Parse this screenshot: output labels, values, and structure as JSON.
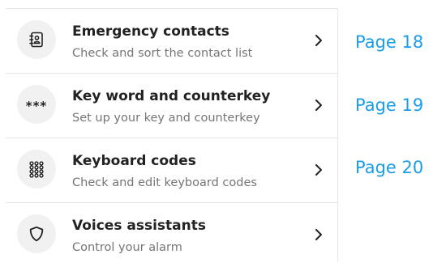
{
  "menu": {
    "items": [
      {
        "title": "Emergency contacts",
        "subtitle": "Check and sort the contact list",
        "icon": "contact-book-icon"
      },
      {
        "title": "Key word and counterkey",
        "subtitle": "Set up your key and counterkey",
        "icon": "asterisks-icon",
        "icon_text": "***"
      },
      {
        "title": "Keyboard codes",
        "subtitle": "Check and edit keyboard codes",
        "icon": "keypad-grid-icon"
      },
      {
        "title": "Voices assistants",
        "subtitle": "Control your alarm",
        "icon": "shield-icon"
      }
    ]
  },
  "page_refs": [
    "Page 18",
    "Page 19",
    "Page 20"
  ],
  "colors": {
    "accent": "#1a9de8",
    "title": "#222222",
    "subtitle": "#757575",
    "icon_bg": "#f1f1f1",
    "divider": "#e2e2e2"
  }
}
